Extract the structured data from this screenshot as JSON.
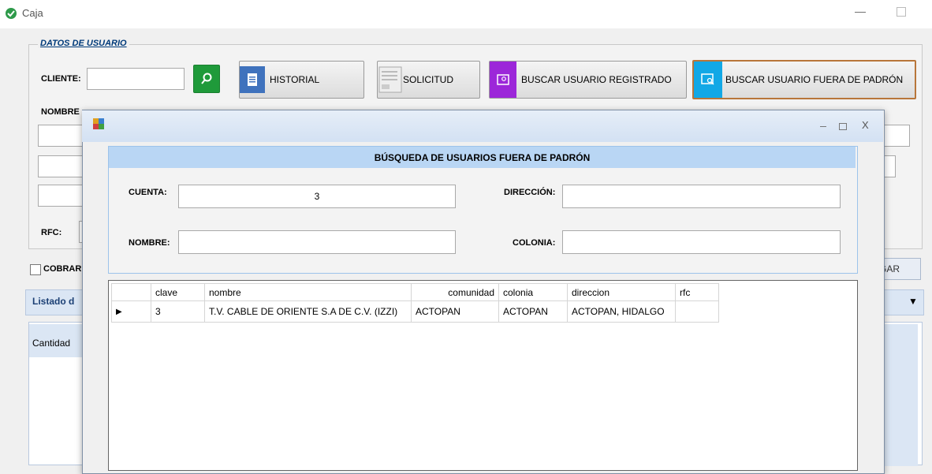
{
  "window": {
    "title": "Caja",
    "minimize": "—"
  },
  "datos_usuario": {
    "title": "DATOS DE USUARIO",
    "cliente_label": "CLIENTE:",
    "cliente_value": "",
    "nombre_label": "NOMBRE",
    "rfc_label": "RFC:",
    "buttons": {
      "historial": "HISTORIAL",
      "solicitud": "SOLICITUD",
      "buscar_registrado": "BUSCAR USUARIO REGISTRADO",
      "buscar_fuera": "BUSCAR USUARIO FUERA DE PADRÓN"
    }
  },
  "cobrar_label": "COBRAR",
  "pagar_tab": "GAR",
  "listado": {
    "title": "Listado d",
    "column": "Cantidad"
  },
  "dialog": {
    "close": "X",
    "header": "BÚSQUEDA DE USUARIOS FUERA DE PADRÓN",
    "cuenta_label": "CUENTA:",
    "cuenta_value": "3",
    "direccion_label": "DIRECCIÓN:",
    "direccion_value": "",
    "nombre_label": "NOMBRE:",
    "nombre_value": "",
    "colonia_label": "COLONIA:",
    "colonia_value": "",
    "grid": {
      "columns": [
        "clave",
        "nombre",
        "comunidad",
        "colonia",
        "direccion",
        "rfc"
      ],
      "rows": [
        [
          "3",
          "T.V. CABLE DE ORIENTE S.A DE C.V. (IZZI)",
          "ACTOPAN",
          "ACTOPAN",
          "ACTOPAN, HIDALGO",
          ""
        ]
      ]
    }
  },
  "colors": {
    "search_green": "#1f9a3a",
    "historial_blue": "#3f72bd",
    "registrado_purple": "#9c27d9",
    "fuera_cyan": "#12a8e6",
    "dialog_header": "#b9d6f4"
  }
}
